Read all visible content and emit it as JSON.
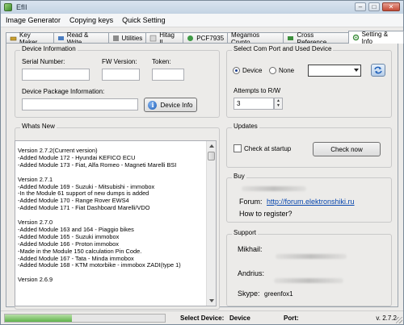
{
  "window": {
    "title": "EfII"
  },
  "menu": [
    "Image Generator",
    "Copying keys",
    "Quick Setting"
  ],
  "tabs": [
    {
      "label": "Key Maker",
      "icon": "key-maker-icon"
    },
    {
      "label": "Read & Write",
      "icon": "read-write-icon"
    },
    {
      "label": "Utilities",
      "icon": "utilities-icon"
    },
    {
      "label": "Hitag II",
      "icon": "hitag-icon"
    },
    {
      "label": "PCF7935",
      "icon": "pcf-icon"
    },
    {
      "label": "Megamos Crypto",
      "icon": "megamos-icon"
    },
    {
      "label": "Cross Reference",
      "icon": "cross-reference-icon"
    },
    {
      "label": "Setting & Info",
      "icon": "settings-gear-icon",
      "active": true
    }
  ],
  "device_info": {
    "title": "Device Information",
    "serial_label": "Serial Number:",
    "fw_label": "FW Version:",
    "token_label": "Token:",
    "package_label": "Device Package Information:",
    "serial_value": "",
    "fw_value": "",
    "token_value": "",
    "package_value": "",
    "button": "Device Info"
  },
  "com_port": {
    "title": "Select Com Port and Used Device",
    "device_label": "Device",
    "none_label": "None",
    "selected": "Device",
    "port_value": "",
    "attempts_label": "Attempts to R/W",
    "attempts_value": "3"
  },
  "whats_new": {
    "title": "Whats New",
    "lines": [
      "Version 2.7.2(Current version)",
      " -Added Module 172 - Hyundai KEFICO ECU",
      " -Added Module 173 - Fiat, Alfa Romeo - Magneti Marelli BSI",
      "",
      "Version 2.7.1",
      " -Added Module 169 - Suzuki - Mitsubishi - immobox",
      " -In the Module 61 support of new dumps is added",
      " -Added Module 170 - Range Rover EWS4",
      " -Added Module 171 - Fiat Dashboard Marelli/VDO",
      "",
      "Version 2.7.0",
      " -Added Module 163 and 164 - Piaggio bikes",
      " -Added Module 165 - Suzuki immobox",
      " -Added Module 166 - Proton immobox",
      " -Made in the Module 150 calculation Pin Code.",
      " -Added Module 167 - Tata - Minda immobox",
      " -Added Module 168 - KTM motorbike - immobox ZADI(type 1)",
      "",
      "Version 2.6.9"
    ]
  },
  "updates": {
    "title": "Updates",
    "checkbox_label": "Check at startup",
    "checked": false,
    "button": "Check now"
  },
  "buy": {
    "title": "Buy",
    "forum_label": "Forum:",
    "forum_link": "http://forum.elektronshiki.ru",
    "register_text": "How to register?"
  },
  "support": {
    "title": "Support",
    "person1": "Mikhail:",
    "person2": "Andrius:",
    "skype_label": "Skype:",
    "skype_value": "greenfox1"
  },
  "status": {
    "progress": 0.42,
    "select_device_label": "Select Device:",
    "select_device_value": "Device",
    "port_label": "Port:",
    "version": "v. 2.7.2"
  }
}
